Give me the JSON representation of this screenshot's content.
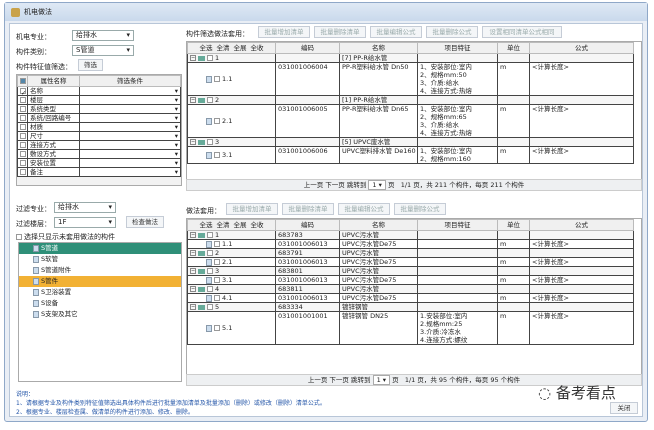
{
  "window": {
    "title": "机电做法"
  },
  "left": {
    "specialty_label": "机电专业：",
    "specialty_value": "给排水",
    "category_label": "构件类别：",
    "category_value": "S管道",
    "feature_filter_label": "构件特征值筛选：",
    "filter_button": "筛选",
    "attr_headers": [
      "属性名称",
      "筛选条件"
    ],
    "attrs": [
      {
        "name": "名称",
        "checked": true
      },
      {
        "name": "楼层"
      },
      {
        "name": "系统类型"
      },
      {
        "name": "系统/回路编号"
      },
      {
        "name": "材质"
      },
      {
        "name": "尺寸"
      },
      {
        "name": "连接方式"
      },
      {
        "name": "敷设方式"
      },
      {
        "name": "安装位置"
      },
      {
        "name": "备注"
      }
    ],
    "filter_specialty_label": "过滤专业：",
    "filter_specialty_value": "给排水",
    "filter_floor_label": "过滤楼层：",
    "filter_floor_value": "1F",
    "check_button": "检查做法",
    "only_unapplied_label": "选择只显示未套用做法的构件",
    "tree": [
      "S管道",
      "S软管",
      "S管道附件",
      "S管件",
      "S卫浴装置",
      "S设备",
      "S支架及其它"
    ]
  },
  "top": {
    "toolbar_label": "构件筛选做法套用：",
    "buttons": [
      "批量增加清单",
      "批量删除清单",
      "批量编辑公式",
      "批量删除公式",
      "设置相同清单公式相同"
    ],
    "select_buttons": [
      "全选",
      "全清",
      "全展",
      "全收"
    ],
    "headers": [
      "编码",
      "名称",
      "项目特征",
      "单位",
      "公式"
    ],
    "rows": [
      {
        "id": "1",
        "group": true,
        "name": "[7] PP-R给水管"
      },
      {
        "id": "1.1",
        "code": "031001006004",
        "name": "PP-R塑料给水管 Dn50",
        "feature": [
          "1、安装部位:室内",
          "2、规格mm:50",
          "3、介质:给水",
          "4、连接方式:热熔"
        ],
        "unit": "m",
        "formula": "<计算长度>"
      },
      {
        "id": "2",
        "group": true,
        "name": "[1] PP-R给水管"
      },
      {
        "id": "2.1",
        "code": "031001006005",
        "name": "PP-R塑料给水管 Dn65",
        "feature": [
          "1、安装部位:室内",
          "2、规格mm:65",
          "3、介质:给水",
          "4、连接方式:热熔"
        ],
        "unit": "m",
        "formula": "<计算长度>"
      },
      {
        "id": "3",
        "group": true,
        "name": "[5] UPVC废水管"
      },
      {
        "id": "3.1",
        "code": "031001006006",
        "name": "UPVC塑料排水管 De160",
        "feature": [
          "1、安装部位:室内",
          "2、规格mm:160"
        ],
        "unit": "m",
        "formula": "<计算长度>"
      }
    ],
    "pager": {
      "prev": "上一页",
      "next": "下一页",
      "jump": "跳转到",
      "page": "1",
      "page_unit": "页",
      "summary": "1/1 页，共 211 个构件，每页 211 个构件"
    }
  },
  "bottom": {
    "toolbar_label": "做法套用：",
    "buttons": [
      "批量增加清单",
      "批量删除清单",
      "批量编辑公式",
      "批量删除公式"
    ],
    "select_buttons": [
      "全选",
      "全清",
      "全展",
      "全收"
    ],
    "headers": [
      "编码",
      "名称",
      "项目特征",
      "单位",
      "公式"
    ],
    "rows": [
      {
        "id": "1",
        "group": true,
        "code": "683783",
        "name": "UPVC污水管"
      },
      {
        "id": "1.1",
        "code": "031001006013",
        "name": "UPVC污水管De75",
        "unit": "m",
        "formula": "<计算长度>"
      },
      {
        "id": "2",
        "group": true,
        "code": "683791",
        "name": "UPVC污水管"
      },
      {
        "id": "2.1",
        "code": "031001006013",
        "name": "UPVC污水管De75",
        "unit": "m",
        "formula": "<计算长度>"
      },
      {
        "id": "3",
        "group": true,
        "code": "683801",
        "name": "UPVC污水管"
      },
      {
        "id": "3.1",
        "code": "031001006013",
        "name": "UPVC污水管De75",
        "unit": "m",
        "formula": "<计算长度>"
      },
      {
        "id": "4",
        "group": true,
        "code": "683811",
        "name": "UPVC污水管"
      },
      {
        "id": "4.1",
        "code": "031001006013",
        "name": "UPVC污水管De75",
        "unit": "m",
        "formula": "<计算长度>"
      },
      {
        "id": "5",
        "group": true,
        "code": "683334",
        "name": "镀锌钢管"
      },
      {
        "id": "5.1",
        "code": "031001001001",
        "name": "镀锌钢管 DN25",
        "feature": [
          "1.安装部位:室内",
          "2.规格mm:25",
          "3.介质:冷冻水",
          "4.连接方式:螺纹"
        ],
        "unit": "m",
        "formula": "<计算长度>"
      }
    ],
    "pager": {
      "prev": "上一页",
      "next": "下一页",
      "jump": "跳转到",
      "page": "1",
      "page_unit": "页",
      "summary": "1/1 页，共 95 个构件，每页 95 个构件"
    }
  },
  "notes": {
    "title": "说明：",
    "lines": [
      "1、请根据专业及构件类别特征值筛选出具体构件后进行批量添加清单及批量添加（删除）或修改（删除）清单公式。",
      "2、根据专业、楼层检查属、做清单的构件进行添加、修改、删除。"
    ]
  },
  "close_button": "关闭",
  "watermark": "备考看点"
}
